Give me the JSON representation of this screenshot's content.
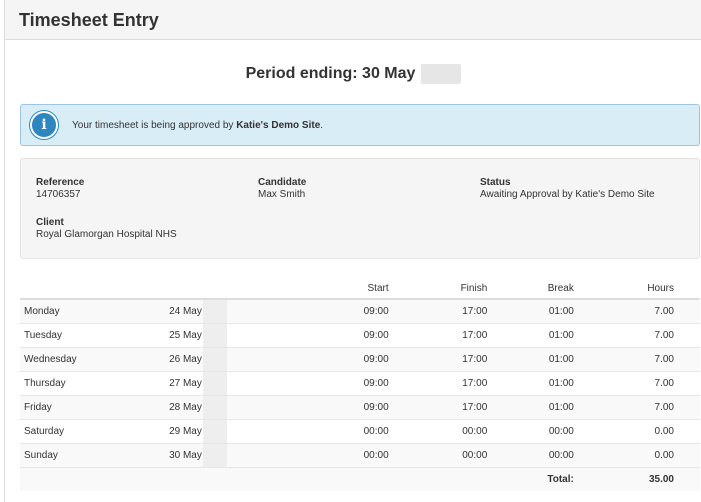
{
  "page": {
    "title": "Timesheet Entry"
  },
  "period": {
    "label": "Period ending: 30 May"
  },
  "alert": {
    "text_before": "Your timesheet is being approved by ",
    "site": "Katie's Demo Site",
    "text_after": "."
  },
  "details": {
    "reference_label": "Reference",
    "reference_value": "14706357",
    "candidate_label": "Candidate",
    "candidate_value": "Max Smith",
    "status_label": "Status",
    "status_value": "Awaiting Approval by Katie's Demo Site",
    "client_label": "Client",
    "client_value": "Royal Glamorgan Hospital NHS"
  },
  "table": {
    "headers": {
      "start": "Start",
      "finish": "Finish",
      "break": "Break",
      "hours": "Hours"
    },
    "rows": [
      {
        "day": "Monday",
        "date": "24 May",
        "start": "09:00",
        "finish": "17:00",
        "break": "01:00",
        "hours": "7.00"
      },
      {
        "day": "Tuesday",
        "date": "25 May",
        "start": "09:00",
        "finish": "17:00",
        "break": "01:00",
        "hours": "7.00"
      },
      {
        "day": "Wednesday",
        "date": "26 May",
        "start": "09:00",
        "finish": "17:00",
        "break": "01:00",
        "hours": "7.00"
      },
      {
        "day": "Thursday",
        "date": "27 May",
        "start": "09:00",
        "finish": "17:00",
        "break": "01:00",
        "hours": "7.00"
      },
      {
        "day": "Friday",
        "date": "28 May",
        "start": "09:00",
        "finish": "17:00",
        "break": "01:00",
        "hours": "7.00"
      },
      {
        "day": "Saturday",
        "date": "29 May",
        "start": "00:00",
        "finish": "00:00",
        "break": "00:00",
        "hours": "0.00"
      },
      {
        "day": "Sunday",
        "date": "30 May",
        "start": "00:00",
        "finish": "00:00",
        "break": "00:00",
        "hours": "0.00"
      }
    ],
    "total_label": "Total:",
    "total_value": "35.00"
  },
  "icons": {
    "alert": "info-icon"
  },
  "colors": {
    "alert_bg": "#d9edf7",
    "alert_border": "#9fc6e0",
    "info_icon": "#2e86c1",
    "heading_bg": "#f5f5f5"
  }
}
